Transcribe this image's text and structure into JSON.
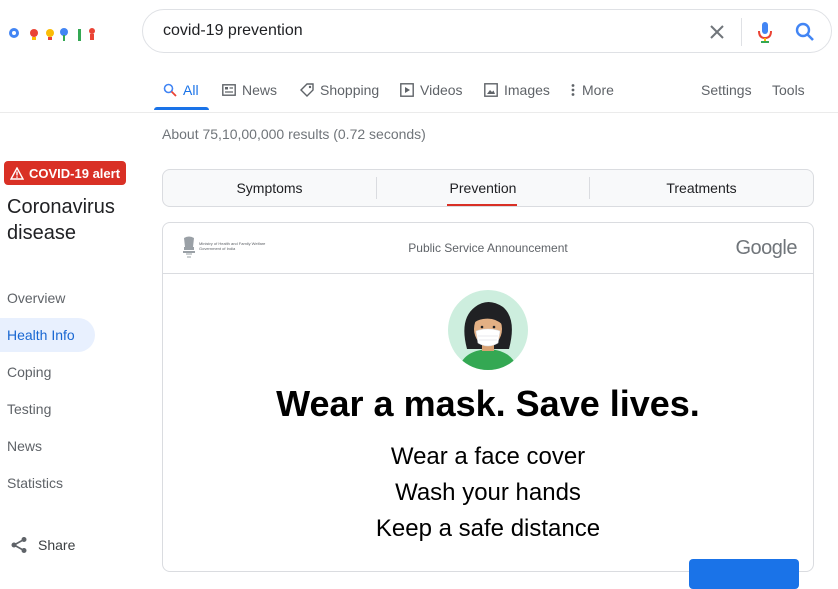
{
  "search": {
    "query": "covid-19 prevention"
  },
  "tabs": [
    {
      "label": "All",
      "icon": "search-icon"
    },
    {
      "label": "News",
      "icon": "news-icon"
    },
    {
      "label": "Shopping",
      "icon": "tag-icon"
    },
    {
      "label": "Videos",
      "icon": "play-icon"
    },
    {
      "label": "Images",
      "icon": "image-icon"
    },
    {
      "label": "More",
      "icon": "more-vertical-icon"
    }
  ],
  "tools": {
    "settings": "Settings",
    "tools": "Tools"
  },
  "result_stats": "About 75,10,00,000 results (0.72 seconds)",
  "sidebar": {
    "alert": "COVID-19 alert",
    "title": "Coronavirus disease",
    "items": [
      "Overview",
      "Health Info",
      "Coping",
      "Testing",
      "News",
      "Statistics"
    ],
    "share": "Share"
  },
  "subnav": {
    "items": [
      "Symptoms",
      "Prevention",
      "Treatments"
    ],
    "active": "Prevention"
  },
  "card": {
    "ministry": "Ministry of Health and Family Welfare Government of India",
    "psa": "Public Service Announcement",
    "brand": "Google",
    "headline": "Wear a mask. Save lives.",
    "lines": [
      "Wear a face cover",
      "Wash your hands",
      "Keep a safe distance"
    ]
  },
  "colors": {
    "accent": "#1a73e8",
    "alert": "#d93025",
    "active_bg": "#e8f0fe"
  }
}
